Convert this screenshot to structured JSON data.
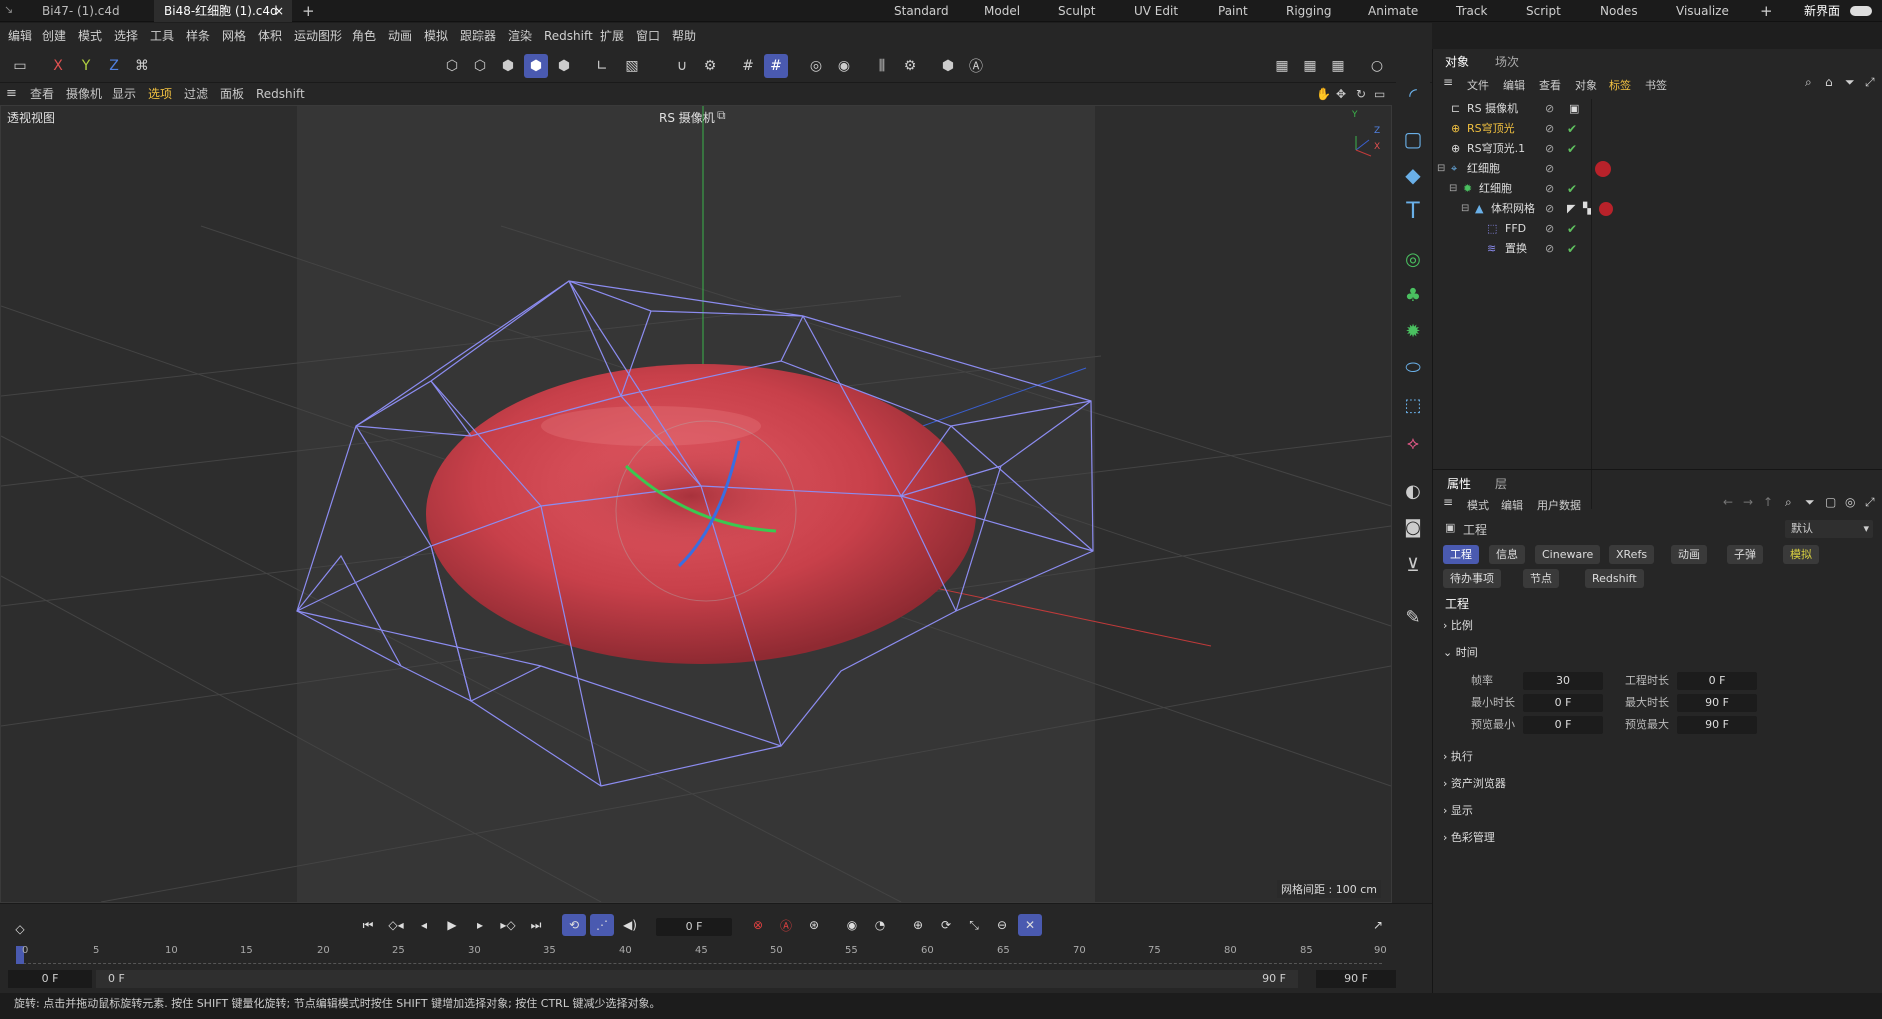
{
  "tabs": [
    {
      "label": "Bi47- (1).c4d",
      "active": false
    },
    {
      "label": "Bi48-红细胞 (1).c4d",
      "active": true
    }
  ],
  "layouts": [
    "Standard",
    "Model",
    "Sculpt",
    "UV Edit",
    "Paint",
    "Rigging",
    "Animate",
    "Track",
    "Script",
    "Nodes",
    "Visualize"
  ],
  "new_interface": "新界面",
  "menu": [
    "编辑",
    "创建",
    "模式",
    "选择",
    "工具",
    "样条",
    "网格",
    "体积",
    "运动图形",
    "角色",
    "动画",
    "模拟",
    "跟踪器",
    "渲染",
    "Redshift",
    "扩展",
    "窗口",
    "帮助"
  ],
  "toolbar": {
    "axis_x": "X",
    "axis_y": "Y",
    "axis_z": "Z"
  },
  "viewport_menu": [
    "查看",
    "摄像机",
    "显示",
    "选项",
    "过滤",
    "面板",
    "Redshift"
  ],
  "viewport": {
    "title": "透视视图",
    "camera": "RS 摄像机",
    "grid_spacing": "网格间距 : 100 cm",
    "axis_y": "Y",
    "axis_z": "Z",
    "axis_x": "X"
  },
  "objects_panel": {
    "tabs": [
      "对象",
      "场次"
    ],
    "menu": [
      "文件",
      "编辑",
      "查看",
      "对象",
      "标签",
      "书签"
    ],
    "rows": [
      {
        "name": "RS 摄像机",
        "indent": 0,
        "selected": false,
        "check": false
      },
      {
        "name": "RS穹顶光",
        "indent": 0,
        "selected": true,
        "check": true
      },
      {
        "name": "RS穹顶光.1",
        "indent": 0,
        "selected": false,
        "check": true
      },
      {
        "name": "红细胞",
        "indent": 0,
        "selected": false,
        "check": false
      },
      {
        "name": "红细胞",
        "indent": 1,
        "selected": false,
        "check": true
      },
      {
        "name": "体积网格",
        "indent": 2,
        "selected": false,
        "check": false
      },
      {
        "name": "FFD",
        "indent": 3,
        "selected": false,
        "check": true
      },
      {
        "name": "置换",
        "indent": 3,
        "selected": false,
        "check": true
      }
    ]
  },
  "attributes_panel": {
    "tabs": [
      "属性",
      "层"
    ],
    "menu": [
      "模式",
      "编辑",
      "用户数据"
    ],
    "object_label": "工程",
    "preset": "默认",
    "buttons_row1": [
      {
        "label": "工程",
        "active": true
      },
      {
        "label": "信息",
        "active": false
      },
      {
        "label": "Cineware",
        "active": false
      },
      {
        "label": "XRefs",
        "active": false
      },
      {
        "label": "动画",
        "active": false
      },
      {
        "label": "子弹",
        "active": false
      },
      {
        "label": "模拟",
        "active": false
      }
    ],
    "buttons_row2": [
      {
        "label": "待办事项",
        "active": false
      },
      {
        "label": "节点",
        "active": false
      },
      {
        "label": "Redshift",
        "active": false
      }
    ],
    "section_title": "工程",
    "sections": [
      "比例",
      "时间",
      "执行",
      "资产浏览器",
      "显示",
      "色彩管理"
    ],
    "time_fields": {
      "fps_label": "帧率",
      "fps": "30",
      "proj_time_label": "工程时长",
      "proj_time": "0 F",
      "min_time_label": "最小时长",
      "min_time": "0 F",
      "max_time_label": "最大时长",
      "max_time": "90 F",
      "preview_min_label": "预览最小",
      "preview_min": "0 F",
      "preview_max_label": "预览最大",
      "preview_max": "90 F"
    }
  },
  "timeline": {
    "current_frame": "0 F",
    "ruler": [
      "0",
      "5",
      "10",
      "15",
      "20",
      "25",
      "30",
      "35",
      "40",
      "45",
      "50",
      "55",
      "60",
      "65",
      "70",
      "75",
      "80",
      "85",
      "90"
    ],
    "start": "0 F",
    "start2": "0 F",
    "end": "90 F",
    "end2": "90 F"
  },
  "status": "旋转: 点击并拖动鼠标旋转元素. 按住 SHIFT 键量化旋转; 节点编辑模式时按住 SHIFT 键增加选择对象; 按住 CTRL 键减少选择对象。",
  "colors": {
    "accent": "#4a5ab0",
    "check": "#5ec05e",
    "selected": "#f0c040",
    "cell": "#c8404a"
  }
}
